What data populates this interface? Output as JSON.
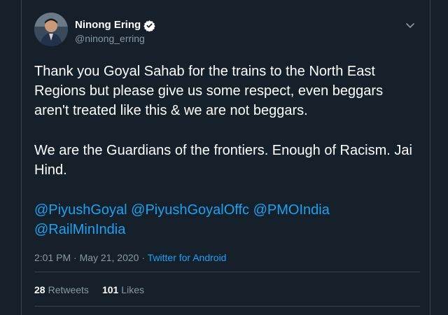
{
  "tweet": {
    "display_name": "Ninong Ering",
    "handle": "@ninong_erring",
    "verified": true,
    "paragraphs": [
      "Thank you Goyal Sahab for the trains to the North East Regions but please give us some respect, even beggars aren't treated like this & we are not beggars.",
      "We are the Guardians of the frontiers. Enough of Racism. Jai Hind."
    ],
    "mentions": [
      "@PiyushGoyal",
      "@PiyushGoyalOffc",
      "@PMOIndia",
      "@RailMinIndia"
    ],
    "time": "2:01 PM",
    "separator": "·",
    "date": "May 21, 2020",
    "source": "Twitter for Android",
    "retweets_count": "28",
    "retweets_label": "Retweets",
    "likes_count": "101",
    "likes_label": "Likes"
  },
  "colors": {
    "background": "#15202b",
    "border": "#38444d",
    "accent": "#1da1f2",
    "muted": "#8899a6",
    "text": "#ffffff"
  },
  "icons": {
    "verified": "verified-badge-icon",
    "caret": "chevron-down-icon"
  }
}
